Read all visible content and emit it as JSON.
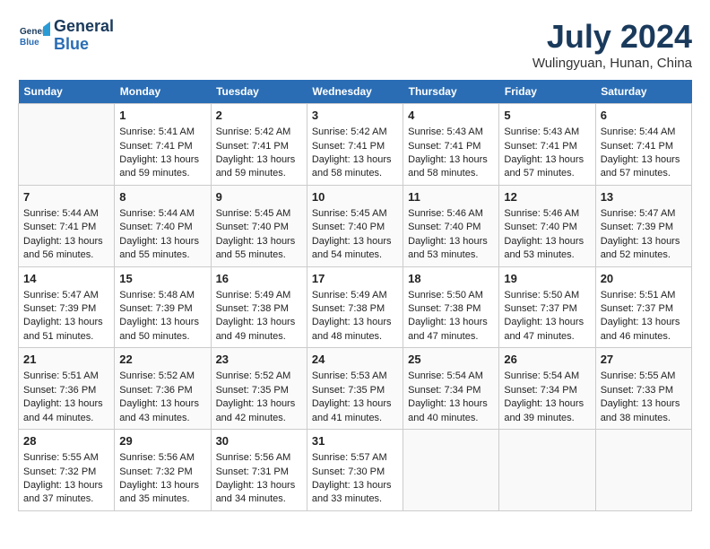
{
  "header": {
    "logo_line1": "General",
    "logo_line2": "Blue",
    "month": "July 2024",
    "location": "Wulingyuan, Hunan, China"
  },
  "days_of_week": [
    "Sunday",
    "Monday",
    "Tuesday",
    "Wednesday",
    "Thursday",
    "Friday",
    "Saturday"
  ],
  "weeks": [
    [
      {
        "day": "",
        "sunrise": "",
        "sunset": "",
        "daylight": ""
      },
      {
        "day": "1",
        "sunrise": "Sunrise: 5:41 AM",
        "sunset": "Sunset: 7:41 PM",
        "daylight": "Daylight: 13 hours and 59 minutes."
      },
      {
        "day": "2",
        "sunrise": "Sunrise: 5:42 AM",
        "sunset": "Sunset: 7:41 PM",
        "daylight": "Daylight: 13 hours and 59 minutes."
      },
      {
        "day": "3",
        "sunrise": "Sunrise: 5:42 AM",
        "sunset": "Sunset: 7:41 PM",
        "daylight": "Daylight: 13 hours and 58 minutes."
      },
      {
        "day": "4",
        "sunrise": "Sunrise: 5:43 AM",
        "sunset": "Sunset: 7:41 PM",
        "daylight": "Daylight: 13 hours and 58 minutes."
      },
      {
        "day": "5",
        "sunrise": "Sunrise: 5:43 AM",
        "sunset": "Sunset: 7:41 PM",
        "daylight": "Daylight: 13 hours and 57 minutes."
      },
      {
        "day": "6",
        "sunrise": "Sunrise: 5:44 AM",
        "sunset": "Sunset: 7:41 PM",
        "daylight": "Daylight: 13 hours and 57 minutes."
      }
    ],
    [
      {
        "day": "7",
        "sunrise": "Sunrise: 5:44 AM",
        "sunset": "Sunset: 7:41 PM",
        "daylight": "Daylight: 13 hours and 56 minutes."
      },
      {
        "day": "8",
        "sunrise": "Sunrise: 5:44 AM",
        "sunset": "Sunset: 7:40 PM",
        "daylight": "Daylight: 13 hours and 55 minutes."
      },
      {
        "day": "9",
        "sunrise": "Sunrise: 5:45 AM",
        "sunset": "Sunset: 7:40 PM",
        "daylight": "Daylight: 13 hours and 55 minutes."
      },
      {
        "day": "10",
        "sunrise": "Sunrise: 5:45 AM",
        "sunset": "Sunset: 7:40 PM",
        "daylight": "Daylight: 13 hours and 54 minutes."
      },
      {
        "day": "11",
        "sunrise": "Sunrise: 5:46 AM",
        "sunset": "Sunset: 7:40 PM",
        "daylight": "Daylight: 13 hours and 53 minutes."
      },
      {
        "day": "12",
        "sunrise": "Sunrise: 5:46 AM",
        "sunset": "Sunset: 7:40 PM",
        "daylight": "Daylight: 13 hours and 53 minutes."
      },
      {
        "day": "13",
        "sunrise": "Sunrise: 5:47 AM",
        "sunset": "Sunset: 7:39 PM",
        "daylight": "Daylight: 13 hours and 52 minutes."
      }
    ],
    [
      {
        "day": "14",
        "sunrise": "Sunrise: 5:47 AM",
        "sunset": "Sunset: 7:39 PM",
        "daylight": "Daylight: 13 hours and 51 minutes."
      },
      {
        "day": "15",
        "sunrise": "Sunrise: 5:48 AM",
        "sunset": "Sunset: 7:39 PM",
        "daylight": "Daylight: 13 hours and 50 minutes."
      },
      {
        "day": "16",
        "sunrise": "Sunrise: 5:49 AM",
        "sunset": "Sunset: 7:38 PM",
        "daylight": "Daylight: 13 hours and 49 minutes."
      },
      {
        "day": "17",
        "sunrise": "Sunrise: 5:49 AM",
        "sunset": "Sunset: 7:38 PM",
        "daylight": "Daylight: 13 hours and 48 minutes."
      },
      {
        "day": "18",
        "sunrise": "Sunrise: 5:50 AM",
        "sunset": "Sunset: 7:38 PM",
        "daylight": "Daylight: 13 hours and 47 minutes."
      },
      {
        "day": "19",
        "sunrise": "Sunrise: 5:50 AM",
        "sunset": "Sunset: 7:37 PM",
        "daylight": "Daylight: 13 hours and 47 minutes."
      },
      {
        "day": "20",
        "sunrise": "Sunrise: 5:51 AM",
        "sunset": "Sunset: 7:37 PM",
        "daylight": "Daylight: 13 hours and 46 minutes."
      }
    ],
    [
      {
        "day": "21",
        "sunrise": "Sunrise: 5:51 AM",
        "sunset": "Sunset: 7:36 PM",
        "daylight": "Daylight: 13 hours and 44 minutes."
      },
      {
        "day": "22",
        "sunrise": "Sunrise: 5:52 AM",
        "sunset": "Sunset: 7:36 PM",
        "daylight": "Daylight: 13 hours and 43 minutes."
      },
      {
        "day": "23",
        "sunrise": "Sunrise: 5:52 AM",
        "sunset": "Sunset: 7:35 PM",
        "daylight": "Daylight: 13 hours and 42 minutes."
      },
      {
        "day": "24",
        "sunrise": "Sunrise: 5:53 AM",
        "sunset": "Sunset: 7:35 PM",
        "daylight": "Daylight: 13 hours and 41 minutes."
      },
      {
        "day": "25",
        "sunrise": "Sunrise: 5:54 AM",
        "sunset": "Sunset: 7:34 PM",
        "daylight": "Daylight: 13 hours and 40 minutes."
      },
      {
        "day": "26",
        "sunrise": "Sunrise: 5:54 AM",
        "sunset": "Sunset: 7:34 PM",
        "daylight": "Daylight: 13 hours and 39 minutes."
      },
      {
        "day": "27",
        "sunrise": "Sunrise: 5:55 AM",
        "sunset": "Sunset: 7:33 PM",
        "daylight": "Daylight: 13 hours and 38 minutes."
      }
    ],
    [
      {
        "day": "28",
        "sunrise": "Sunrise: 5:55 AM",
        "sunset": "Sunset: 7:32 PM",
        "daylight": "Daylight: 13 hours and 37 minutes."
      },
      {
        "day": "29",
        "sunrise": "Sunrise: 5:56 AM",
        "sunset": "Sunset: 7:32 PM",
        "daylight": "Daylight: 13 hours and 35 minutes."
      },
      {
        "day": "30",
        "sunrise": "Sunrise: 5:56 AM",
        "sunset": "Sunset: 7:31 PM",
        "daylight": "Daylight: 13 hours and 34 minutes."
      },
      {
        "day": "31",
        "sunrise": "Sunrise: 5:57 AM",
        "sunset": "Sunset: 7:30 PM",
        "daylight": "Daylight: 13 hours and 33 minutes."
      },
      {
        "day": "",
        "sunrise": "",
        "sunset": "",
        "daylight": ""
      },
      {
        "day": "",
        "sunrise": "",
        "sunset": "",
        "daylight": ""
      },
      {
        "day": "",
        "sunrise": "",
        "sunset": "",
        "daylight": ""
      }
    ]
  ]
}
